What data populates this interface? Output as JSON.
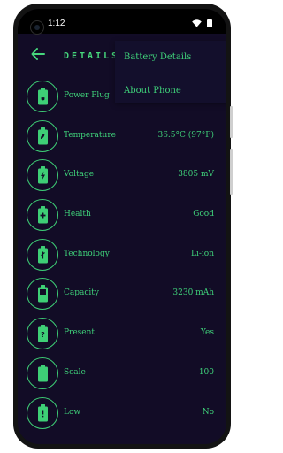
{
  "status": {
    "time": "1:12",
    "icons": [
      "wifi-icon",
      "battery-icon"
    ]
  },
  "toolbar": {
    "title": "DETAILS",
    "back_icon": "arrow-left-icon"
  },
  "menu": {
    "items": [
      "Battery Details",
      "About Phone"
    ]
  },
  "rows": [
    {
      "label": "Power Plug",
      "value": "",
      "icon": "battery-power-icon"
    },
    {
      "label": "Temperature",
      "value": "36.5°C (97°F)",
      "icon": "battery-temperature-icon"
    },
    {
      "label": "Voltage",
      "value": "3805 mV",
      "icon": "battery-charging-icon"
    },
    {
      "label": "Health",
      "value": "Good",
      "icon": "battery-health-icon"
    },
    {
      "label": "Technology",
      "value": "Li-ion",
      "icon": "battery-technology-icon"
    },
    {
      "label": "Capacity",
      "value": "3230 mAh",
      "icon": "battery-capacity-icon"
    },
    {
      "label": "Present",
      "value": "Yes",
      "icon": "battery-unknown-icon"
    },
    {
      "label": "Scale",
      "value": "100",
      "icon": "battery-full-icon"
    },
    {
      "label": "Low",
      "value": "No",
      "icon": "battery-alert-icon"
    }
  ],
  "colors": {
    "background": "#120c26",
    "accent": "#3fd27a",
    "statusbar": "#000000"
  }
}
